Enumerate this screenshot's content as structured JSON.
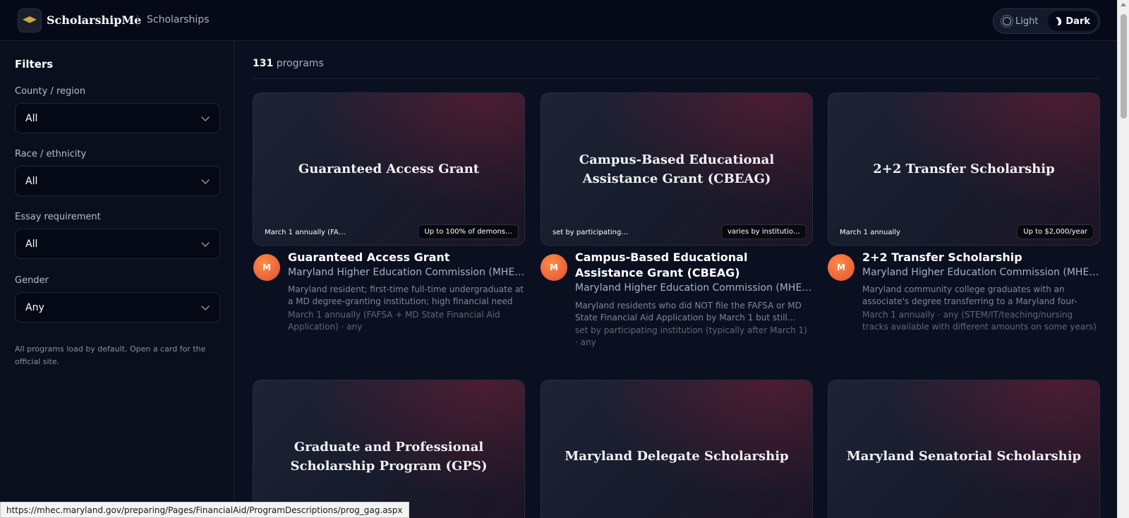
{
  "header": {
    "brand": "ScholarshipMe",
    "section": "Scholarships",
    "theme_light": "Light",
    "theme_dark": "Dark"
  },
  "sidebar": {
    "title": "Filters",
    "filters": [
      {
        "label": "County / region",
        "value": "All"
      },
      {
        "label": "Race / ethnicity",
        "value": "All"
      },
      {
        "label": "Essay requirement",
        "value": "All"
      },
      {
        "label": "Gender",
        "value": "Any"
      }
    ],
    "note": "All programs load by default. Open a card for the official site."
  },
  "main": {
    "count_number": "131",
    "count_label": "programs",
    "cards": [
      {
        "image_title": "Guaranteed Access Grant",
        "deadline_chip": "March 1 annually (FA…",
        "amount_chip": "Up to 100% of demons…",
        "avatar": "M",
        "title": "Guaranteed Access Grant",
        "org": "Maryland Higher Education Commission (MHEC)…",
        "desc": "Maryland resident; first-time full-time undergraduate at a MD degree-granting institution; high financial need (per…",
        "meta": "March 1 annually (FAFSA + MD State Financial Aid Application) · any"
      },
      {
        "image_title": "Campus-Based Educational Assistance Grant (CBEAG)",
        "deadline_chip": "set by participating…",
        "amount_chip": "varies by institutio…",
        "avatar": "M",
        "title": "Campus-Based Educational Assistance Grant (CBEAG)",
        "org": "Maryland Higher Education Commission (MHEC)…",
        "desc": "Maryland residents who did NOT file the FAFSA or MD State Financial Aid Application by March 1 but still…",
        "meta": "set by participating institution (typically after March 1) · any"
      },
      {
        "image_title": "2+2 Transfer Scholarship",
        "deadline_chip": "March 1 annually",
        "amount_chip": "Up to $2,000/year",
        "avatar": "M",
        "title": "2+2 Transfer Scholarship",
        "org": "Maryland Higher Education Commission (MHEC)…",
        "desc": "Maryland community college graduates with an associate's degree transferring to a Maryland four-year…",
        "meta": "March 1 annually · any (STEM/IT/teaching/nursing tracks available with different amounts on some years)"
      },
      {
        "image_title": "Graduate and Professional Scholarship Program (GPS)"
      },
      {
        "image_title": "Maryland Delegate Scholarship"
      },
      {
        "image_title": "Maryland Senatorial Scholarship"
      }
    ]
  },
  "statusbar": {
    "url": "https://mhec.maryland.gov/preparing/Pages/FinancialAid/ProgramDescriptions/prog_gag.aspx"
  }
}
